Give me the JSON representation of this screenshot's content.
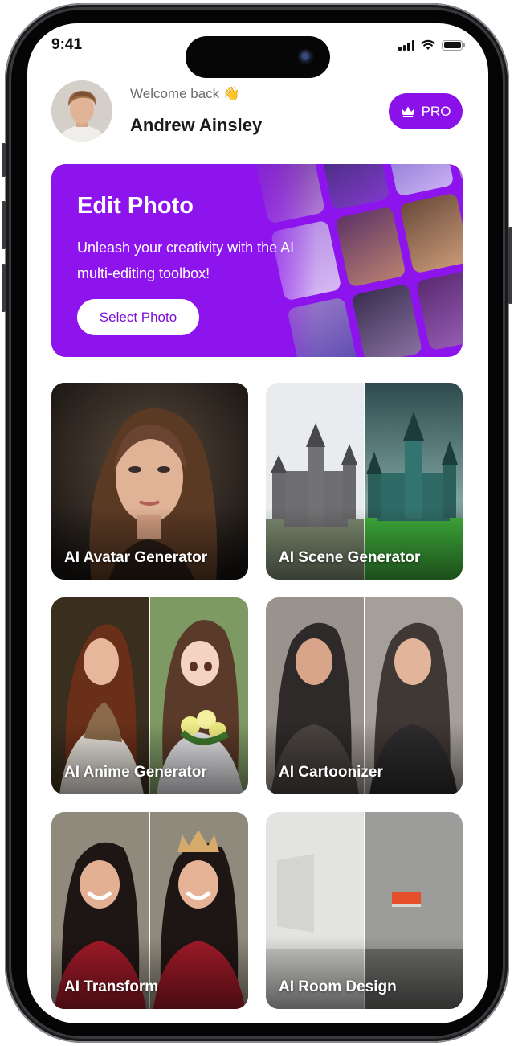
{
  "status_bar": {
    "time": "9:41"
  },
  "header": {
    "welcome": "Welcome back 👋",
    "username": "Andrew Ainsley",
    "pro_label": "PRO"
  },
  "banner": {
    "title": "Edit Photo",
    "subtitle": "Unleash your creativity with the AI multi-editing toolbox!",
    "button_label": "Select Photo"
  },
  "features": [
    {
      "label": "AI Avatar Generator"
    },
    {
      "label": "AI Scene Generator"
    },
    {
      "label": "AI Anime Generator"
    },
    {
      "label": "AI Cartoonizer"
    },
    {
      "label": "AI Transform"
    },
    {
      "label": "AI Room Design"
    }
  ],
  "colors": {
    "accent": "#8e14ee",
    "pro_button": "#8a12e8",
    "select_text": "#7a10d8"
  },
  "icons": [
    "signal-icon",
    "wifi-icon",
    "battery-icon",
    "crown-icon"
  ]
}
